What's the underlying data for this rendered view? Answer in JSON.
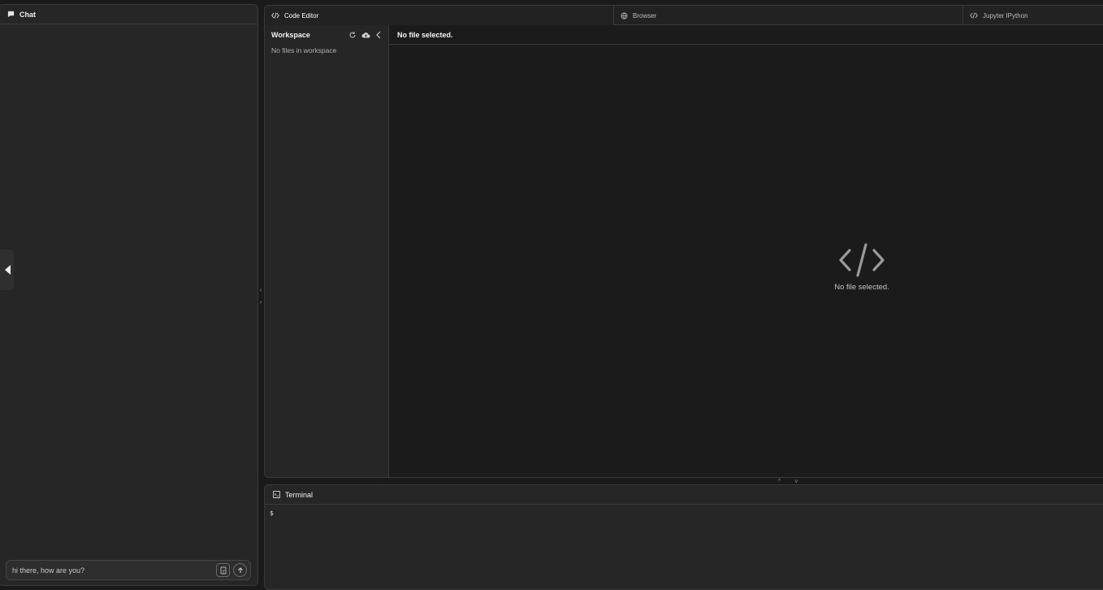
{
  "chat": {
    "title": "Chat",
    "input_value": "hi there, how are you?"
  },
  "tabs": [
    {
      "label": "Code Editor",
      "icon": "code-icon",
      "active": true
    },
    {
      "label": "Browser",
      "icon": "globe-icon",
      "active": false
    },
    {
      "label": "Jupyter IPython",
      "icon": "code-icon",
      "active": false
    }
  ],
  "workspace": {
    "title": "Workspace",
    "empty_text": "No files in workspace",
    "actions": [
      "refresh-icon",
      "cloud-upload-icon",
      "chevron-left-icon"
    ]
  },
  "editor": {
    "header": "No file selected.",
    "empty_text": "No file selected."
  },
  "terminal": {
    "title": "Terminal",
    "prompt": "$"
  },
  "colors": {
    "background": "#1a1a1a",
    "panel": "#262626",
    "border": "#3a3a3a",
    "editor_bg": "#1b1b1b"
  }
}
